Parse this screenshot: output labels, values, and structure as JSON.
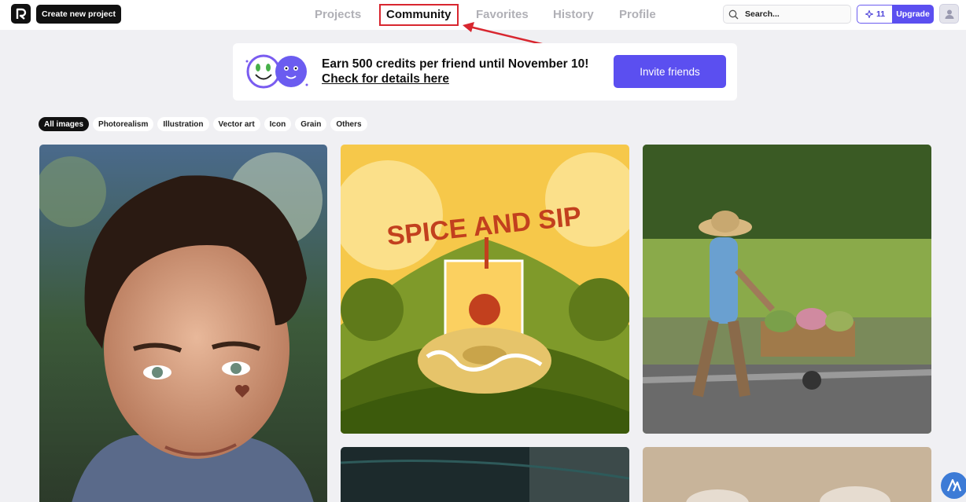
{
  "header": {
    "create_label": "Create new project",
    "nav": [
      "Projects",
      "Community",
      "Favorites",
      "History",
      "Profile"
    ],
    "active_nav": "Community",
    "search_placeholder": "Search...",
    "credits": "11",
    "upgrade_label": "Upgrade"
  },
  "banner": {
    "line1": "Earn 500 credits per friend until November 10!",
    "line2": "Check for details here",
    "button": "Invite friends"
  },
  "filters": [
    "All images",
    "Photorealism",
    "Illustration",
    "Vector art",
    "Icon",
    "Grain",
    "Others"
  ],
  "active_filter": "All images",
  "gallery": {
    "card2_text": "SPICE AND SIP"
  },
  "colors": {
    "accent": "#5b4ff0",
    "highlight": "#d8262f"
  },
  "icons": {
    "logo": "app-logo-icon",
    "search": "search-icon",
    "credits": "sparkle-icon",
    "avatar": "user-avatar-icon"
  }
}
